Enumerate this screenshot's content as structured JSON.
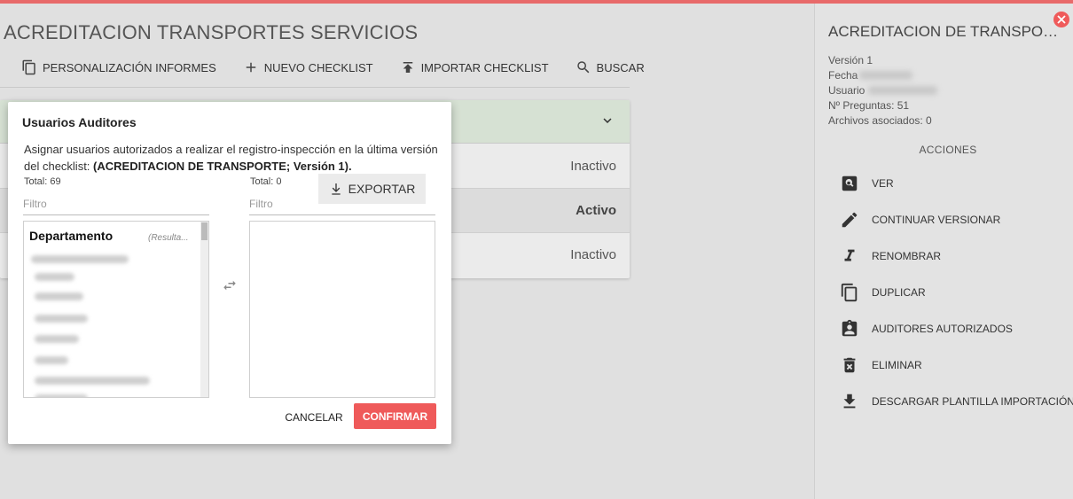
{
  "page": {
    "title": "ACREDITACION TRANSPORTES SERVICIOS"
  },
  "toolbar": {
    "items": [
      {
        "label": "PERSONALIZACIÓN INFORMES",
        "icon": "copy-icon"
      },
      {
        "label": "NUEVO CHECKLIST",
        "icon": "plus-icon"
      },
      {
        "label": "IMPORTAR CHECKLIST",
        "icon": "upload-icon"
      },
      {
        "label": "BUSCAR",
        "icon": "search-icon"
      }
    ]
  },
  "list": {
    "rows": [
      {
        "status": "Inactivo"
      },
      {
        "status": "Activo"
      },
      {
        "status": "Inactivo"
      }
    ]
  },
  "modal": {
    "title": "Usuarios Auditores",
    "description_prefix": "Asignar usuarios autorizados a realizar el registro-inspección en la última versión del checklist: ",
    "description_bold": "(ACREDITACION DE TRANSPORTE; Versión 1).",
    "left": {
      "total": "Total: 69",
      "filter_placeholder": "Filtro",
      "group_header": "Departamento",
      "hint": "(Resulta..."
    },
    "right": {
      "total": "Total: 0",
      "filter_placeholder": "Filtro"
    },
    "export_label": "EXPORTAR",
    "cancel_label": "CANCELAR",
    "confirm_label": "CONFIRMAR"
  },
  "side": {
    "title": "ACREDITACION DE TRANSPORTE",
    "version": "Versión 1",
    "fecha_label": "Fecha",
    "usuario_label": "Usuario",
    "preguntas": "Nº Preguntas: 51",
    "archivos": "Archivos asociados: 0",
    "actions_label": "ACCIONES",
    "actions": [
      {
        "label": "VER",
        "icon": "view-icon"
      },
      {
        "label": "CONTINUAR VERSIONAR",
        "icon": "pencil-icon"
      },
      {
        "label": "RENOMBRAR",
        "icon": "italic-icon"
      },
      {
        "label": "DUPLICAR",
        "icon": "copy-icon"
      },
      {
        "label": "AUDITORES AUTORIZADOS",
        "icon": "clipboard-user-icon"
      },
      {
        "label": "ELIMINAR",
        "icon": "trash-icon"
      },
      {
        "label": "DESCARGAR PLANTILLA IMPORTACIÓN",
        "icon": "download-icon"
      }
    ]
  },
  "colors": {
    "accent": "#ef5a5a",
    "list_header": "#d6e1d3"
  }
}
